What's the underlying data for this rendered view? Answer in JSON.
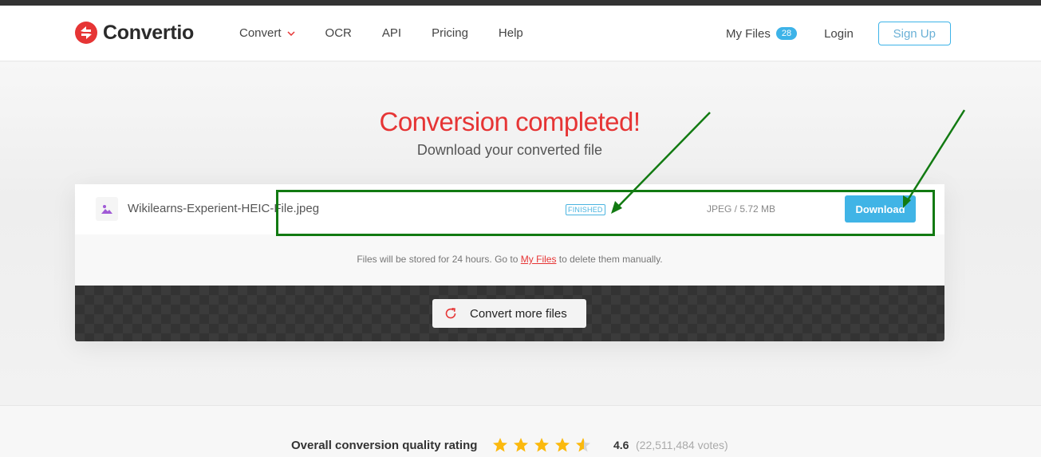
{
  "header": {
    "logo_text": "Convertio",
    "nav": [
      {
        "label": "Convert",
        "has_dropdown": true
      },
      {
        "label": "OCR"
      },
      {
        "label": "API"
      },
      {
        "label": "Pricing"
      },
      {
        "label": "Help"
      }
    ],
    "my_files_label": "My Files",
    "my_files_count": "28",
    "login_label": "Login",
    "signup_label": "Sign Up"
  },
  "main": {
    "title": "Conversion completed!",
    "subtitle": "Download your converted file",
    "file": {
      "name": "Wikilearns-Experient-HEIC-File.jpeg",
      "icon": "image-icon",
      "status": "FINISHED",
      "meta": "JPEG / 5.72 MB",
      "download_label": "Download"
    },
    "store_info": {
      "before": "Files will be stored for 24 hours. Go to ",
      "link": "My Files",
      "after": " to delete them manually."
    },
    "convert_more_label": "Convert more files"
  },
  "rating": {
    "label": "Overall conversion quality rating",
    "stars": 4.6,
    "value": "4.6",
    "votes": "(22,511,484 votes)"
  },
  "colors": {
    "brand_red": "#e63535",
    "accent_blue": "#40b4e6",
    "annotation_green": "#127a12",
    "star_gold": "#fbb90e"
  }
}
